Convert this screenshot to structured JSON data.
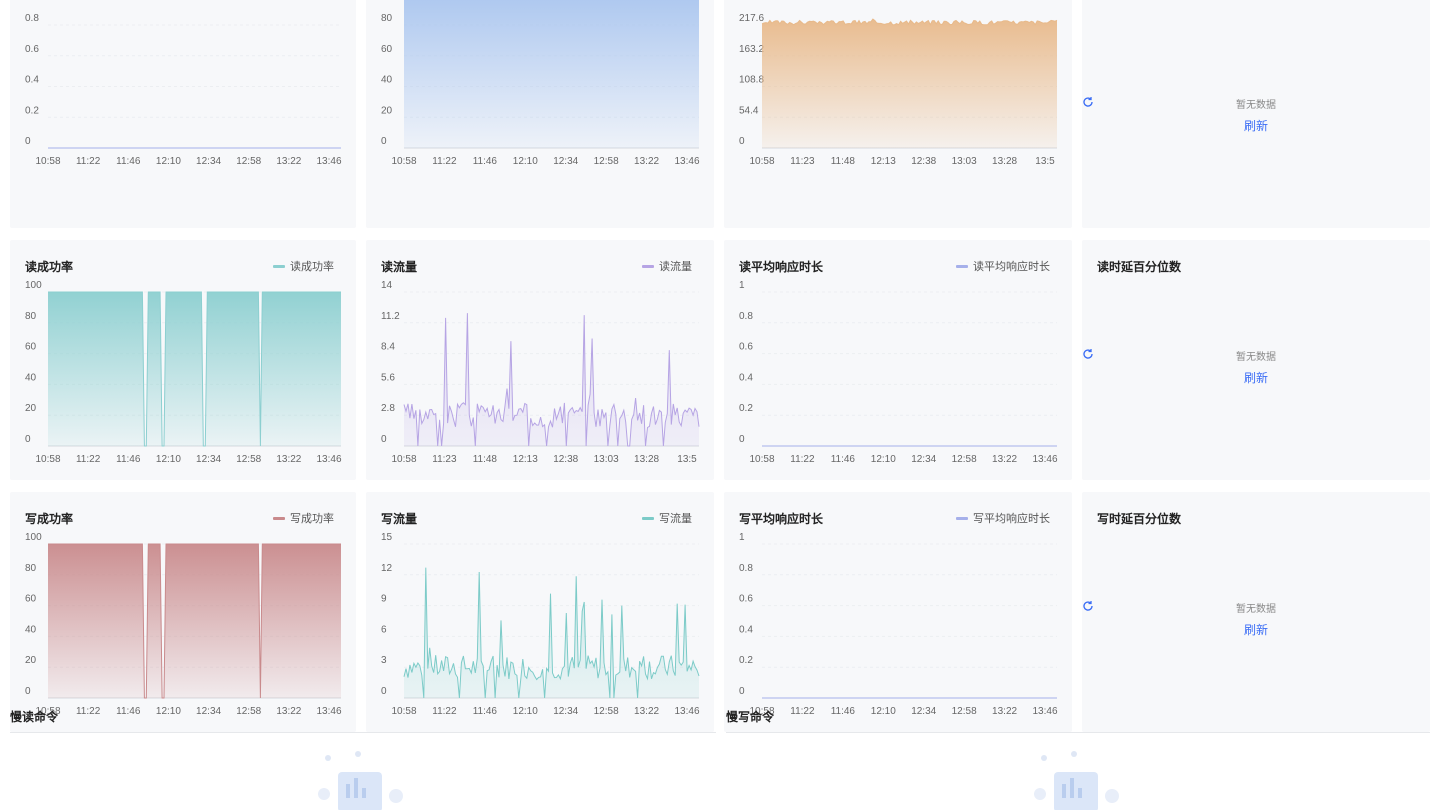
{
  "colors": {
    "blue": "#a9c5ef",
    "orange": "#e8b98a",
    "teal": "#8ccfd0",
    "purple": "#b6a4e4",
    "red": "#c98a8c",
    "teal2": "#7ccbc8",
    "lavender": "#a6b0ea",
    "link": "#3b6df5"
  },
  "nodata": {
    "text": "暂无数据",
    "refresh": "刷新"
  },
  "charts": [
    {
      "id": "c0",
      "title": "",
      "legend": "",
      "type": "line",
      "color": "#a6b0ea",
      "yticks": [
        "0",
        "0.2",
        "0.4",
        "0.6",
        "0.8"
      ],
      "ylim": [
        0,
        0.8
      ],
      "xticks": [
        "10:58",
        "11:22",
        "11:46",
        "12:10",
        "12:34",
        "12:58",
        "13:22",
        "13:46"
      ],
      "series": {
        "kind": "flat",
        "value": 0
      }
    },
    {
      "id": "c1",
      "title": "",
      "legend": "",
      "type": "area",
      "color": "#a9c5ef",
      "yticks": [
        "0",
        "20",
        "40",
        "60",
        "80"
      ],
      "ylim": [
        0,
        80
      ],
      "xticks": [
        "10:58",
        "11:22",
        "11:46",
        "12:10",
        "12:34",
        "12:58",
        "13:22",
        "13:46"
      ],
      "series": {
        "kind": "flat",
        "value": 100
      }
    },
    {
      "id": "c2",
      "title": "",
      "legend": "",
      "type": "area",
      "color": "#e8b98a",
      "yticks": [
        "0",
        "54.4",
        "108.8",
        "163.2",
        "217.6"
      ],
      "ylim": [
        0,
        217.6
      ],
      "xticks": [
        "10:58",
        "11:23",
        "11:48",
        "12:13",
        "12:38",
        "13:03",
        "13:28",
        "13:5"
      ],
      "series": {
        "kind": "noisy",
        "base": 222,
        "amp": 8
      }
    },
    {
      "id": "c3",
      "title": "",
      "nodata": true
    },
    {
      "id": "c4",
      "title": "读成功率",
      "legend": "读成功率",
      "type": "area",
      "color": "#8ccfd0",
      "yticks": [
        "0",
        "20",
        "40",
        "60",
        "80",
        "100"
      ],
      "ylim": [
        0,
        100
      ],
      "xticks": [
        "10:58",
        "11:22",
        "11:46",
        "12:10",
        "12:34",
        "12:58",
        "13:22",
        "13:46"
      ],
      "series": {
        "kind": "dips",
        "value": 100,
        "dips": [
          0.33,
          0.39,
          0.53,
          0.72
        ]
      }
    },
    {
      "id": "c5",
      "title": "读流量",
      "legend": "读流量",
      "type": "spiky",
      "color": "#b6a4e4",
      "yticks": [
        "0",
        "2.8",
        "5.6",
        "8.4",
        "11.2",
        "14"
      ],
      "ylim": [
        0,
        14
      ],
      "xticks": [
        "10:58",
        "11:23",
        "11:48",
        "12:13",
        "12:38",
        "13:03",
        "13:28",
        "13:5"
      ],
      "series": {
        "kind": "spiky",
        "seed": 3,
        "base": 2.8,
        "max": 12.5
      }
    },
    {
      "id": "c6",
      "title": "读平均响应时长",
      "legend": "读平均响应时长",
      "type": "line",
      "color": "#a6b0ea",
      "yticks": [
        "0",
        "0.2",
        "0.4",
        "0.6",
        "0.8",
        "1"
      ],
      "ylim": [
        0,
        1
      ],
      "xticks": [
        "10:58",
        "11:22",
        "11:46",
        "12:10",
        "12:34",
        "12:58",
        "13:22",
        "13:46"
      ],
      "series": {
        "kind": "flat",
        "value": 0
      }
    },
    {
      "id": "c7",
      "title": "读时延百分位数",
      "nodata": true
    },
    {
      "id": "c8",
      "title": "写成功率",
      "legend": "写成功率",
      "type": "area",
      "color": "#c98a8c",
      "yticks": [
        "0",
        "20",
        "40",
        "60",
        "80",
        "100"
      ],
      "ylim": [
        0,
        100
      ],
      "xticks": [
        "10:58",
        "11:22",
        "11:46",
        "12:10",
        "12:34",
        "12:58",
        "13:22",
        "13:46"
      ],
      "series": {
        "kind": "dips",
        "value": 100,
        "dips": [
          0.33,
          0.39,
          0.72
        ]
      }
    },
    {
      "id": "c9",
      "title": "写流量",
      "legend": "写流量",
      "type": "spiky",
      "color": "#7ccbc8",
      "yticks": [
        "0",
        "3",
        "6",
        "9",
        "12",
        "15"
      ],
      "ylim": [
        0,
        15
      ],
      "xticks": [
        "10:58",
        "11:22",
        "11:46",
        "12:10",
        "12:34",
        "12:58",
        "13:22",
        "13:46"
      ],
      "series": {
        "kind": "spiky",
        "seed": 7,
        "base": 3,
        "max": 13
      }
    },
    {
      "id": "c10",
      "title": "写平均响应时长",
      "legend": "写平均响应时长",
      "type": "line",
      "color": "#a6b0ea",
      "yticks": [
        "0",
        "0.2",
        "0.4",
        "0.6",
        "0.8",
        "1"
      ],
      "ylim": [
        0,
        1
      ],
      "xticks": [
        "10:58",
        "11:22",
        "11:46",
        "12:10",
        "12:34",
        "12:58",
        "13:22",
        "13:46"
      ],
      "series": {
        "kind": "flat",
        "value": 0
      }
    },
    {
      "id": "c11",
      "title": "写时延百分位数",
      "nodata": true
    }
  ],
  "sections": {
    "slow_read": "慢读命令",
    "slow_write": "慢写命令"
  }
}
